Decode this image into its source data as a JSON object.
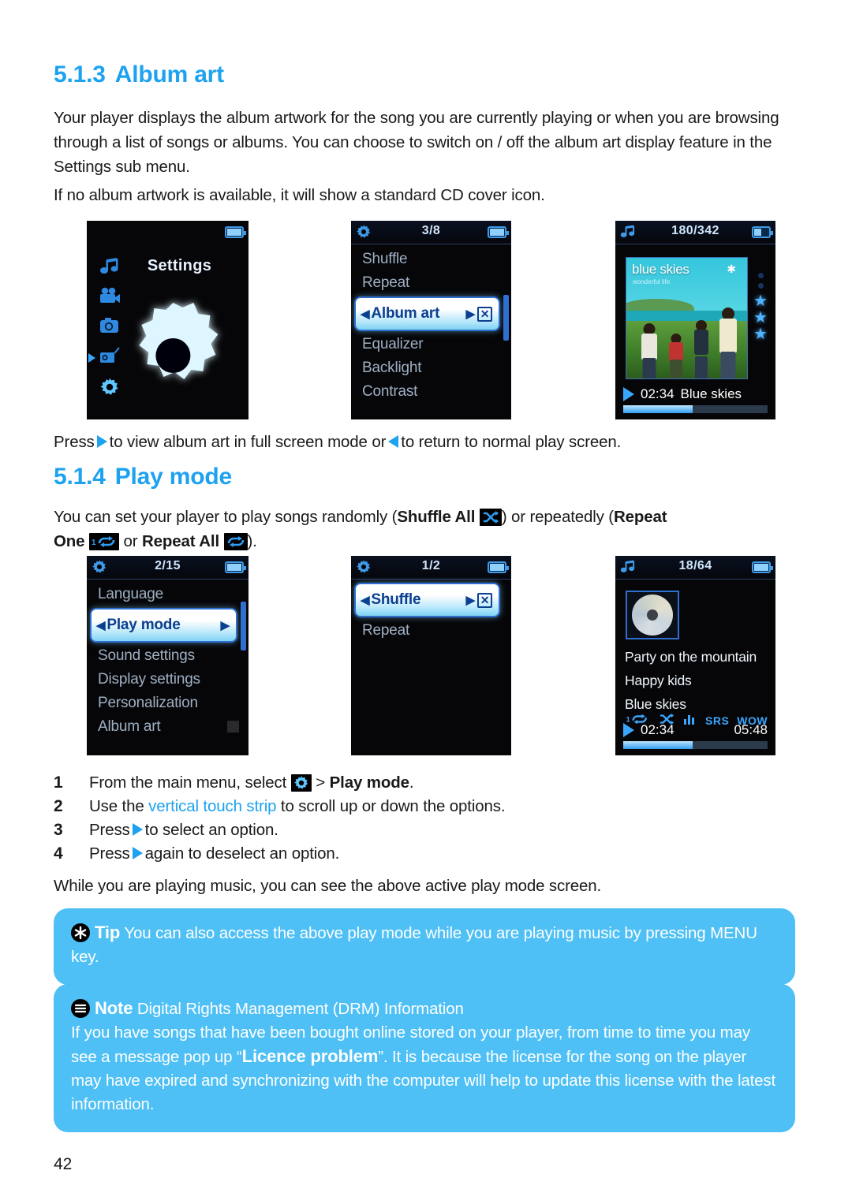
{
  "page_number": "42",
  "sections": {
    "album_art": {
      "number": "5.1.3",
      "title": "Album art",
      "para1": "Your player displays the album artwork for the song you are currently playing or when you are browsing through a list of songs or albums. You can choose to switch on / off the album art display feature in the Settings sub menu.",
      "para2": "If no album artwork is available, it will show a standard CD cover icon.",
      "press_line_a": "Press",
      "press_line_b": "to view album art in full screen mode or",
      "press_line_c": "to return to normal play screen."
    },
    "play_mode": {
      "number": "5.1.4",
      "title": "Play mode",
      "intro_a": "You can set your player to play songs randomly (",
      "intro_shuffle_all": "Shuffle All",
      "intro_b": ") or repeatedly (",
      "intro_repeat_one": "Repeat",
      "intro_repeat_one2": "One",
      "intro_or": "or",
      "intro_repeat_all": "Repeat All",
      "intro_c": ").",
      "steps": [
        {
          "n": "1",
          "pre": "From the main menu, select",
          "icon": "gear-icon",
          "post": ">",
          "bold": "Play mode",
          "tail": "."
        },
        {
          "n": "2",
          "pre": "Use the",
          "accent": "vertical touch strip",
          "post": "to scroll up or down the options."
        },
        {
          "n": "3",
          "pre": "Press",
          "icon": "right-arrow-icon",
          "post": "to select an option."
        },
        {
          "n": "4",
          "pre": "Press",
          "icon": "right-arrow-icon",
          "post": "again to deselect an option."
        }
      ],
      "closing": "While you are playing music, you can see the above active play mode screen."
    }
  },
  "callouts": {
    "tip": {
      "badge": "asterisk-icon",
      "keyword": "Tip",
      "text": "You can also access the above play mode while you are playing music by pressing MENU key."
    },
    "note": {
      "badge": "note-icon",
      "keyword": "Note",
      "title": "Digital Rights Management (DRM) Information",
      "text_a": "If you have songs that have been bought online stored on your player, from time to time you may see a message pop up “",
      "text_bold": "Licence problem",
      "text_b": "”. It is because the license for the song on the player may have expired and synchronizing with the computer will help to update this license with the latest information."
    }
  },
  "screens": {
    "row1": [
      {
        "id": "main-menu-settings",
        "type": "mainmenu",
        "title": "Settings",
        "battery": "battery-full-icon",
        "side_icons": [
          "music-note-icon",
          "video-camera-icon",
          "photo-camera-icon",
          "radio-icon",
          "gear-icon"
        ],
        "selected_index": 4
      },
      {
        "id": "settings-submenu-album-art",
        "type": "menu",
        "header_icon": "gear-icon",
        "counter": "3/8",
        "battery": "battery-full-icon",
        "items": [
          {
            "label": "Shuffle",
            "selected": false
          },
          {
            "label": "Repeat",
            "selected": false
          },
          {
            "label": "Album art",
            "selected": true,
            "check": "☒"
          },
          {
            "label": "Equalizer",
            "selected": false
          },
          {
            "label": "Backlight",
            "selected": false
          },
          {
            "label": "Contrast",
            "selected": false
          }
        ]
      },
      {
        "id": "now-playing-album-art",
        "type": "albumart",
        "header_icon": "music-note-icon",
        "counter": "180/342",
        "battery": "battery-half-icon",
        "album_title": "blue skies",
        "album_subtitle": "wonderful life",
        "rating_dots": 2,
        "rating_stars": 3,
        "elapsed": "02:34",
        "track": "Blue skies",
        "progress_percent": 48
      }
    ],
    "row2": [
      {
        "id": "settings-menu-play-mode",
        "type": "menu",
        "header_icon": "gear-icon",
        "counter": "2/15",
        "battery": "battery-full-icon",
        "items": [
          {
            "label": "Language",
            "selected": false
          },
          {
            "label": "Play mode",
            "selected": true,
            "check": ""
          },
          {
            "label": "Sound settings",
            "selected": false
          },
          {
            "label": "Display settings",
            "selected": false
          },
          {
            "label": "Personalization",
            "selected": false
          },
          {
            "label": "Album art",
            "selected": false,
            "checkbox": true
          }
        ]
      },
      {
        "id": "play-mode-submenu",
        "type": "menu",
        "header_icon": "gear-icon",
        "counter": "1/2",
        "battery": "battery-full-icon",
        "items": [
          {
            "label": "Shuffle",
            "selected": true,
            "check": "☒"
          },
          {
            "label": "Repeat",
            "selected": false
          }
        ]
      },
      {
        "id": "now-playing-cd-icon",
        "type": "cdicon",
        "header_icon": "music-note-icon",
        "counter": "18/64",
        "battery": "battery-full-icon",
        "cover": "cd-cover-icon",
        "tracks": [
          "Party on the mountain",
          "Happy kids",
          "Blue skies"
        ],
        "mode_icons": [
          "repeat-one-icon",
          "shuffle-icon",
          "equalizer-icon"
        ],
        "srs_label": "SRS",
        "wow_label": "WOW",
        "elapsed": "02:34",
        "total": "05:48",
        "progress_percent": 48
      }
    ]
  },
  "colors": {
    "accent": "#1ea2f0",
    "callout_bg": "#4ec0f5",
    "screen_bg": "#060608",
    "select_text": "#0b3f8f"
  }
}
